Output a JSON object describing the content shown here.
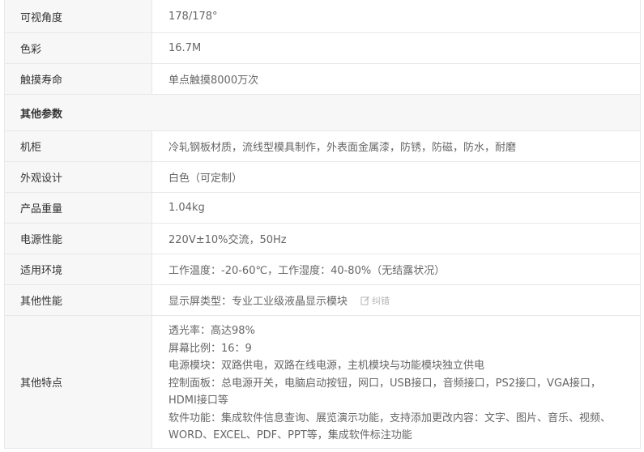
{
  "rows_top": [
    {
      "key": "可视角度",
      "value": "178/178°"
    },
    {
      "key": "色彩",
      "value": "16.7M"
    },
    {
      "key": "触摸寿命",
      "value": "单点触摸8000万次"
    }
  ],
  "section_title": "其他参数",
  "rows_other": [
    {
      "key": "机柜",
      "value": "冷轧钢板材质，流线型模具制作，外表面金属漆，防锈，防磁，防水，耐磨"
    },
    {
      "key": "外观设计",
      "value": "白色（可定制）"
    },
    {
      "key": "产品重量",
      "value": "1.04kg"
    },
    {
      "key": "电源性能",
      "value": "220V±10%交流，50Hz"
    },
    {
      "key": "适用环境",
      "value": "工作温度：-20-60℃，工作湿度：40-80%（无结露状况）"
    }
  ],
  "other_perf": {
    "key": "其他性能",
    "value": "显示屏类型：专业工业级液晶显示模块",
    "feedback_label": "纠错"
  },
  "features": {
    "key": "其他特点",
    "lines": [
      "透光率：高达98%",
      "屏幕比例：16：9",
      "电源模块：双路供电，双路在线电源，主机模块与功能模块独立供电",
      "控制面板：总电源开关，电脑启动按钮，网口，USB接口，音频接口，PS2接口，VGA接口，HDMI接口等",
      "软件功能：集成软件信息查询、展览演示功能，支持添加更改内容：文字、图片、音乐、视频、WORD、EXCEL、PDF、PPT等，集成软件标注功能"
    ]
  }
}
